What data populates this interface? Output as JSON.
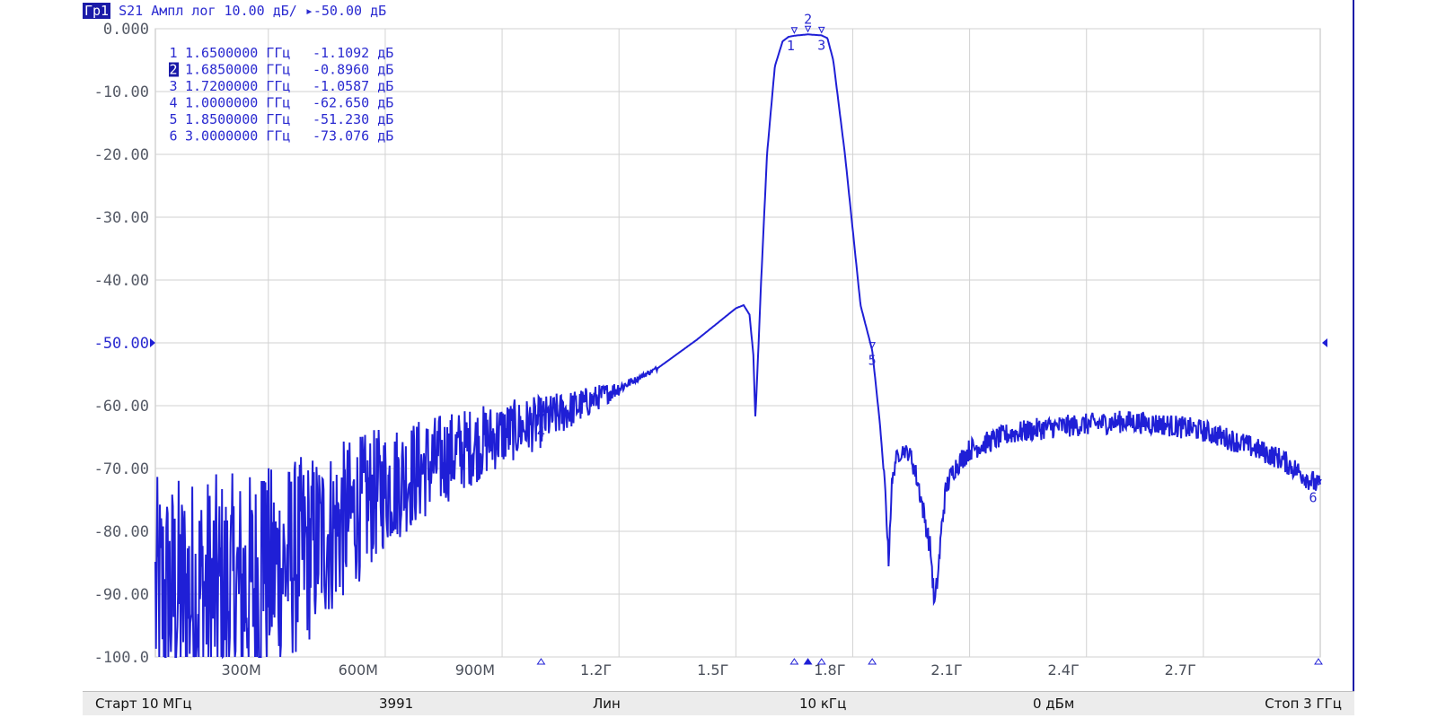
{
  "title_bar": {
    "trace_id": "Гр1",
    "trace_info": "S21 Ампл лог 10.00 дБ/ ▸-50.00 дБ"
  },
  "marker_table": [
    {
      "num": "1",
      "freq": "1.6500000 ГГц",
      "value": "-1.1092 дБ",
      "active": false
    },
    {
      "num": "2",
      "freq": "1.6850000 ГГц",
      "value": "-0.8960 дБ",
      "active": true
    },
    {
      "num": "3",
      "freq": "1.7200000 ГГц",
      "value": "-1.0587 дБ",
      "active": false
    },
    {
      "num": "4",
      "freq": "1.0000000 ГГц",
      "value": "-62.650 дБ",
      "active": false
    },
    {
      "num": "5",
      "freq": "1.8500000 ГГц",
      "value": "-51.230 дБ",
      "active": false
    },
    {
      "num": "6",
      "freq": "3.0000000 ГГц",
      "value": "-73.076 дБ",
      "active": false
    }
  ],
  "status_bar": {
    "start": "Старт 10 МГц",
    "points": "3991",
    "sweep_type": "Лин",
    "if_bandwidth": "10 кГц",
    "power": "0 дБм",
    "stop": "Стоп 3 ГГц"
  },
  "colors": {
    "trace": "#1f1fd6",
    "text": "#2a2ad0",
    "grid": "#d2d2d2",
    "active_marker_bg": "#1a1aa8"
  },
  "chart_data": {
    "type": "line",
    "xlabel": "",
    "ylabel": "",
    "x_range_ghz": [
      0.01,
      3.0
    ],
    "ylim": [
      -100,
      0
    ],
    "reference_level": -50,
    "grid": true,
    "y_ticks": [
      "0.000",
      "-10.00",
      "-20.00",
      "-30.00",
      "-40.00",
      "-50.00",
      "-60.00",
      "-70.00",
      "-80.00",
      "-90.00",
      "-100.0"
    ],
    "y_tick_values": [
      0,
      -10,
      -20,
      -30,
      -40,
      -50,
      -60,
      -70,
      -80,
      -90,
      -100
    ],
    "x_ticks": [
      "300M",
      "600M",
      "900M",
      "1.2Г",
      "1.5Г",
      "1.8Г",
      "2.1Г",
      "2.4Г",
      "2.7Г"
    ],
    "x_tick_values": [
      0.3,
      0.6,
      0.9,
      1.2,
      1.5,
      1.8,
      2.1,
      2.4,
      2.7
    ],
    "series": [
      {
        "x": [
          0.01,
          0.1,
          0.2,
          0.25,
          0.3,
          0.4,
          0.5,
          0.6,
          0.7,
          0.8,
          0.9,
          1.0,
          1.1,
          1.2,
          1.3,
          1.4,
          1.45,
          1.5,
          1.52,
          1.535,
          1.545,
          1.55,
          1.555,
          1.565,
          1.58,
          1.6,
          1.62,
          1.635,
          1.65,
          1.685,
          1.72,
          1.735,
          1.75,
          1.78,
          1.8,
          1.82,
          1.85,
          1.87,
          1.885,
          1.892,
          1.895,
          1.9,
          1.91,
          1.93,
          1.95,
          1.97,
          2.0,
          2.01,
          2.02,
          2.03,
          2.04,
          2.06,
          2.1,
          2.2,
          2.3,
          2.4,
          2.5,
          2.6,
          2.7,
          2.8,
          2.9,
          3.0
        ],
        "values": [
          -91,
          -90,
          -90,
          -89,
          -87,
          -83,
          -78,
          -73,
          -70,
          -67,
          -64.5,
          -62.6,
          -60,
          -57.2,
          -54,
          -49.5,
          -47,
          -44.5,
          -44,
          -45.5,
          -52,
          -62,
          -55,
          -40,
          -20,
          -6,
          -2,
          -1.3,
          -1.11,
          -0.9,
          -1.06,
          -1.5,
          -5,
          -20,
          -32,
          -44,
          -51.2,
          -63,
          -75,
          -85,
          -80,
          -73,
          -68.5,
          -67,
          -68,
          -73,
          -83,
          -92,
          -86,
          -78,
          -73,
          -70,
          -67,
          -64.5,
          -63.5,
          -63,
          -62.5,
          -63,
          -64,
          -66,
          -68.5,
          -73
        ]
      }
    ],
    "markers": [
      {
        "label": "1",
        "x": 1.65,
        "y": -1.1092
      },
      {
        "label": "2",
        "x": 1.685,
        "y": -0.896
      },
      {
        "label": "3",
        "x": 1.72,
        "y": -1.0587
      },
      {
        "label": "4",
        "x": 1.0,
        "y": -62.65
      },
      {
        "label": "5",
        "x": 1.85,
        "y": -51.23
      },
      {
        "label": "6",
        "x": 3.0,
        "y": -73.076
      }
    ]
  }
}
